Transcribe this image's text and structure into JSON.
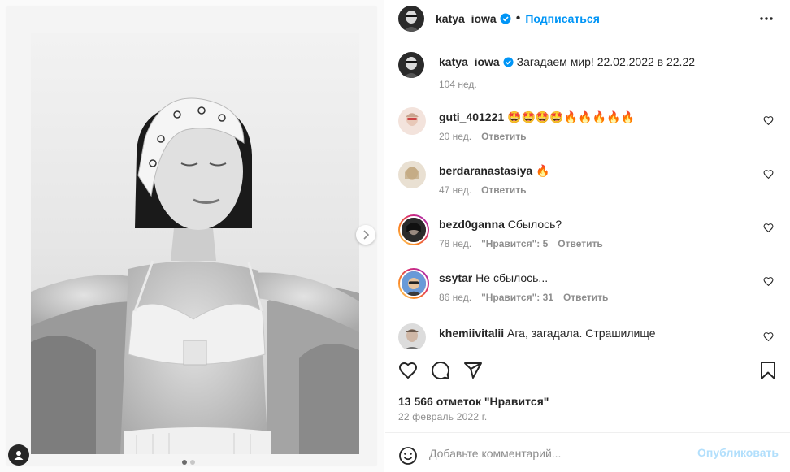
{
  "post": {
    "author": "katya_iowa",
    "follow_label": "Подписаться",
    "caption_author": "katya_iowa",
    "caption_text": "Загадаем мир! 22.02.2022 в 22.22",
    "caption_time": "104 нед."
  },
  "comments": [
    {
      "user": "guti_401221",
      "text": "🤩🤩🤩🤩🔥🔥🔥🔥🔥",
      "time": "20 нед.",
      "likes": "",
      "reply": "Ответить"
    },
    {
      "user": "berdaranastasiya",
      "text": "🔥",
      "time": "47 нед.",
      "likes": "",
      "reply": "Ответить"
    },
    {
      "user": "bezd0ganna",
      "text": "Сбылось?",
      "time": "78 нед.",
      "likes": "\"Нравится\": 5",
      "reply": "Ответить"
    },
    {
      "user": "ssytar",
      "text": "Не сбылось...",
      "time": "86 нед.",
      "likes": "\"Нравится\": 31",
      "reply": "Ответить"
    },
    {
      "user": "khemiivitalii",
      "text": "Ага, загадала. Страшилище",
      "time": "",
      "likes": "",
      "reply": ""
    }
  ],
  "stats": {
    "likes_text": "13 566 отметок \"Нравится\"",
    "date": "22 февраль 2022 г."
  },
  "composer": {
    "placeholder": "Добавьте комментарий...",
    "post_label": "Опубликовать"
  },
  "carousel": {
    "current": 1,
    "total": 2
  },
  "icons": [
    "heart-icon",
    "comment-icon",
    "share-icon",
    "bookmark-icon",
    "more-icon",
    "emoji-icon",
    "verified-icon",
    "chevron-right-icon",
    "user-tag-icon"
  ],
  "colors": {
    "accent": "#0095f6",
    "post_disabled": "#b2dffc",
    "secondary_text": "#8e8e8e"
  }
}
